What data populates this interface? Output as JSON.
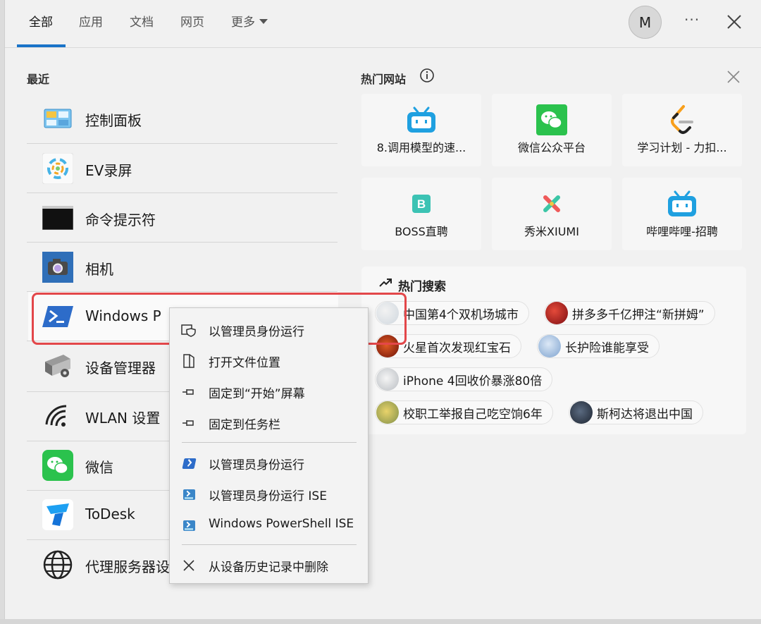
{
  "tabs": [
    {
      "label": "全部"
    },
    {
      "label": "应用"
    },
    {
      "label": "文档"
    },
    {
      "label": "网页"
    },
    {
      "label": "更多"
    }
  ],
  "header": {
    "avatar_initial": "M",
    "more_glyph": "···"
  },
  "recent": {
    "title": "最近",
    "items": [
      {
        "label": "控制面板",
        "icon": "control-panel-icon"
      },
      {
        "label": "EV录屏",
        "icon": "ev-recorder-icon"
      },
      {
        "label": "命令提示符",
        "icon": "cmd-icon"
      },
      {
        "label": "相机",
        "icon": "camera-icon"
      },
      {
        "label": "Windows P",
        "icon": "powershell-icon"
      },
      {
        "label": "设备管理器",
        "icon": "device-manager-icon"
      },
      {
        "label": "WLAN 设置",
        "icon": "wifi-icon"
      },
      {
        "label": "微信",
        "icon": "wechat-icon"
      },
      {
        "label": "ToDesk",
        "icon": "todesk-icon"
      },
      {
        "label": "代理服务器设",
        "icon": "globe-icon"
      }
    ]
  },
  "hot_sites": {
    "title": "热门网站",
    "items": [
      {
        "label": "8.调用模型的速...",
        "icon": "bilibili-icon"
      },
      {
        "label": "微信公众平台",
        "icon": "wechat-icon"
      },
      {
        "label": "学习计划 - 力扣...",
        "icon": "leetcode-icon"
      },
      {
        "label": "BOSS直聘",
        "icon": "boss-icon"
      },
      {
        "label": "秀米XIUMI",
        "icon": "xiumi-icon"
      },
      {
        "label": "哔哩哔哩-招聘",
        "icon": "bilibili-icon"
      }
    ]
  },
  "hot_search": {
    "title": "热门搜索",
    "items": [
      {
        "label": "中国第4个双机场城市"
      },
      {
        "label": "拼多多千亿押注“新拼姆”"
      },
      {
        "label": "火星首次发现红宝石"
      },
      {
        "label": "长护险谁能享受"
      },
      {
        "label": "iPhone 4回收价暴涨80倍"
      },
      {
        "label": "校职工举报自己吃空饷6年"
      },
      {
        "label": "斯柯达将退出中国"
      }
    ]
  },
  "context_menu": {
    "items": [
      {
        "label": "以管理员身份运行",
        "icon": "shield-icon"
      },
      {
        "label": "打开文件位置",
        "icon": "file-location-icon"
      },
      {
        "label": "固定到“开始”屏幕",
        "icon": "pin-icon"
      },
      {
        "label": "固定到任务栏",
        "icon": "pin-icon"
      },
      {
        "label": "以管理员身份运行",
        "icon": "powershell-icon"
      },
      {
        "label": "以管理员身份运行 ISE",
        "icon": "powershell-ise-icon"
      },
      {
        "label": "Windows PowerShell ISE",
        "icon": "powershell-ise-icon"
      },
      {
        "label": "从设备历史记录中删除",
        "icon": "close-icon"
      }
    ]
  },
  "colors": {
    "accent": "#1a73c8",
    "annotation_red": "#e3474a",
    "bilibili_blue": "#1fa0e0",
    "wechat_green": "#2bc24d"
  }
}
